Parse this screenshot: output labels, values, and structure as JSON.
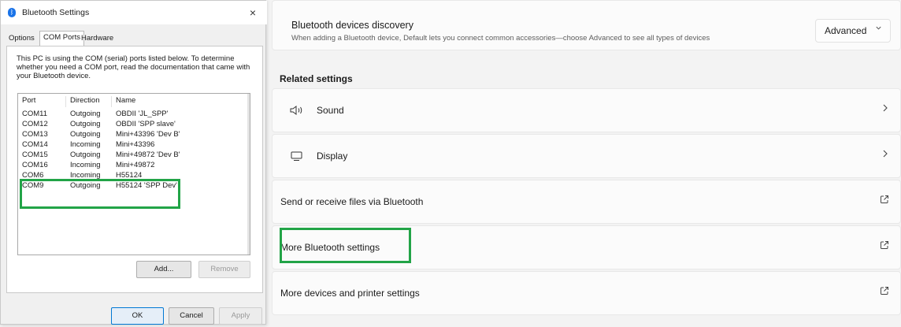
{
  "settings": {
    "discovery": {
      "title": "Bluetooth devices discovery",
      "subtitle": "When adding a Bluetooth device, Default lets you connect common accessories—choose Advanced to see all types of devices",
      "dropdown_value": "Advanced",
      "dropdown_icon": "chevron-down-icon"
    },
    "related_title": "Related settings",
    "rows": [
      {
        "label": "Sound",
        "icon": "speaker-icon",
        "end_icon": "chevron-right-icon"
      },
      {
        "label": "Display",
        "icon": "monitor-icon",
        "end_icon": "chevron-right-icon"
      },
      {
        "label": "Send or receive files via Bluetooth",
        "end_icon": "external-link-icon"
      },
      {
        "label": "More Bluetooth settings",
        "end_icon": "external-link-icon"
      },
      {
        "label": "More devices and printer settings",
        "end_icon": "external-link-icon"
      }
    ],
    "highlight_color": "#22a447"
  },
  "dialog": {
    "title": "Bluetooth Settings",
    "close_symbol": "×",
    "tabs": [
      "Options",
      "COM Ports",
      "Hardware"
    ],
    "active_tab": "COM Ports",
    "description": "This PC is using the COM (serial) ports listed below. To determine whether you need a COM port, read the documentation that came with your Bluetooth device.",
    "columns": [
      "Port",
      "Direction",
      "Name"
    ],
    "ports": [
      {
        "port": "COM11",
        "direction": "Outgoing",
        "name": "OBDII 'JL_SPP'"
      },
      {
        "port": "COM12",
        "direction": "Outgoing",
        "name": "OBDII 'SPP slave'"
      },
      {
        "port": "COM13",
        "direction": "Outgoing",
        "name": "Mini+43396 'Dev B'"
      },
      {
        "port": "COM14",
        "direction": "Incoming",
        "name": "Mini+43396"
      },
      {
        "port": "COM15",
        "direction": "Outgoing",
        "name": "Mini+49872 'Dev B'"
      },
      {
        "port": "COM16",
        "direction": "Incoming",
        "name": "Mini+49872"
      },
      {
        "port": "COM6",
        "direction": "Incoming",
        "name": "H55124"
      },
      {
        "port": "COM9",
        "direction": "Outgoing",
        "name": "H55124 'SPP Dev'"
      }
    ],
    "buttons": {
      "add": "Add...",
      "remove": "Remove",
      "ok": "OK",
      "cancel": "Cancel",
      "apply": "Apply"
    }
  }
}
